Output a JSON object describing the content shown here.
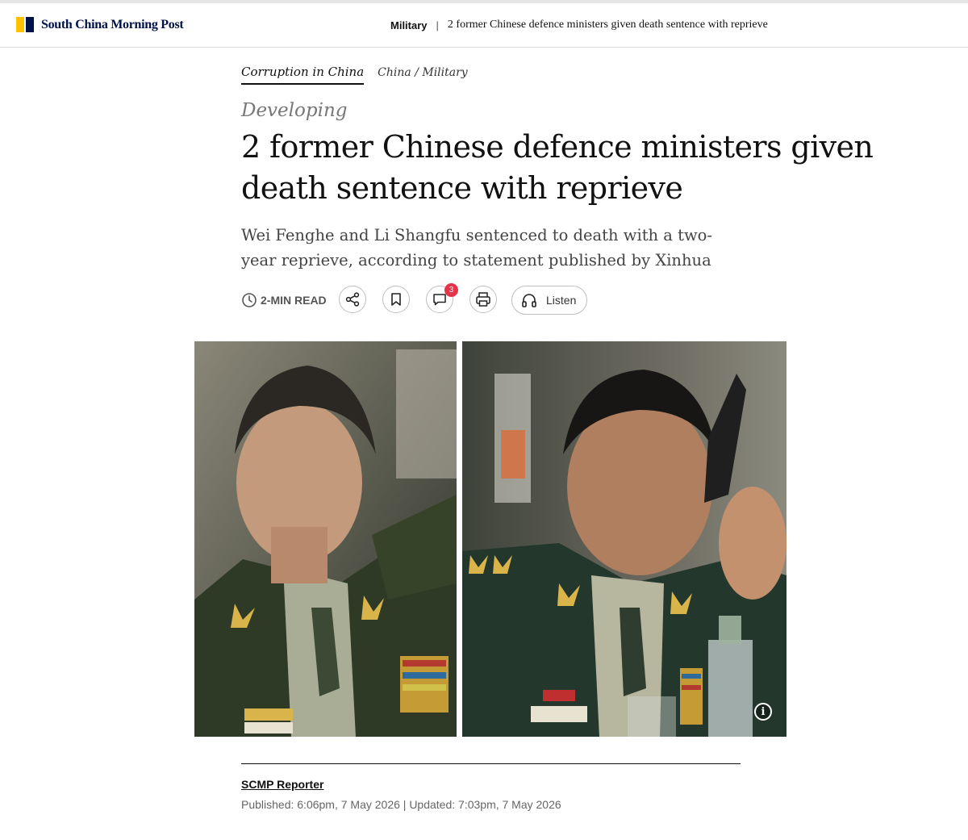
{
  "header": {
    "brand": "South China Morning Post",
    "section": "Military",
    "separator": "|",
    "title": "2 former Chinese defence ministers given death sentence with reprieve"
  },
  "article": {
    "topic": "Corruption in China",
    "section_path": "China / Military",
    "flag": "Developing",
    "headline": "2 former Chinese defence ministers given death sentence with reprieve",
    "summary": "Wei Fenghe and Li Shangfu sentenced to death with a two-year reprieve, according to statement published by Xinhua",
    "read_time": "2-MIN READ",
    "comment_count": "3",
    "listen_label": "Listen",
    "image_info": "i",
    "author": "SCMP Reporter",
    "dates": "Published: 6:06pm, 7 May 2026 | Updated: 7:03pm, 7 May 2026"
  },
  "icons": {
    "clock": "clock-icon",
    "share": "share-icon",
    "bookmark": "bookmark-icon",
    "comment": "comment-icon",
    "print": "print-icon",
    "headphones": "headphones-icon",
    "info": "info-icon"
  },
  "colors": {
    "brand_yellow": "#ffc200",
    "brand_navy": "#001246",
    "badge_red": "#e5344a",
    "flag_grey": "#777777"
  }
}
